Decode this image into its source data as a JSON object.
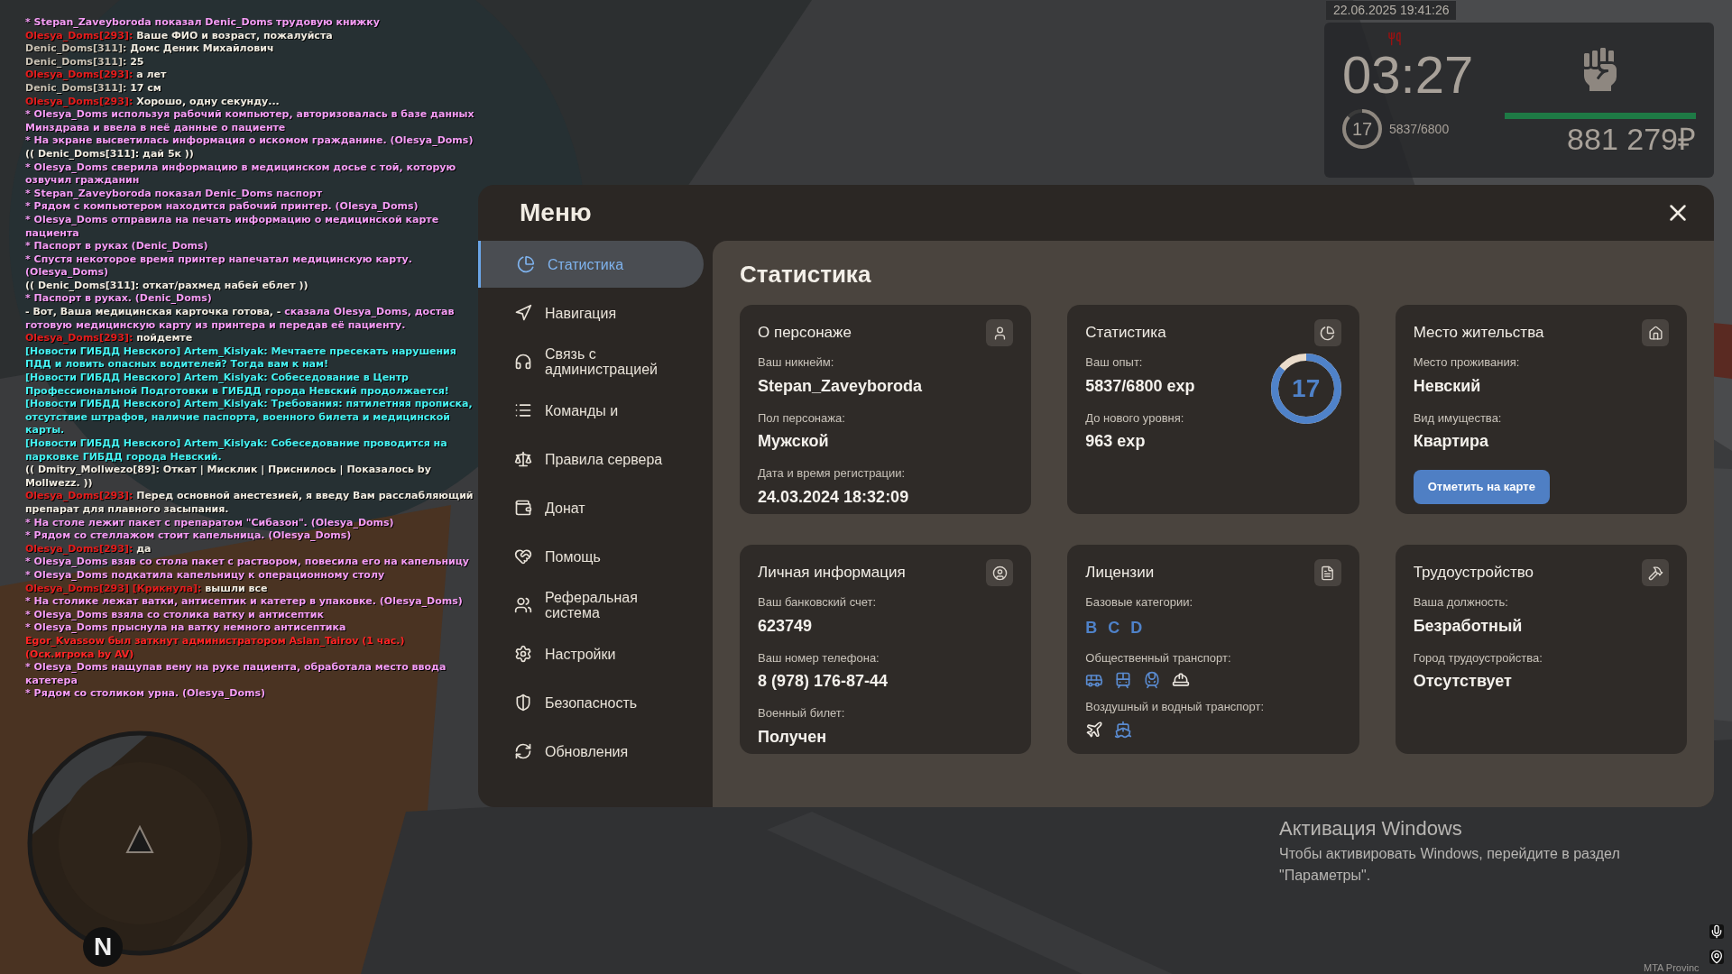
{
  "chat": [
    {
      "segments": [
        {
          "kind": "action",
          "text": "* Stepan_Zaveyboroda показал Denic_Doms трудовую книжку"
        }
      ]
    },
    {
      "segments": [
        {
          "kind": "name",
          "text": "Olesya_Doms[293]:"
        },
        {
          "kind": "speech",
          "text": " Ваше ФИО и возраст, пожалуйста"
        }
      ]
    },
    {
      "segments": [
        {
          "kind": "local",
          "text": "Denic_Doms[311]:"
        },
        {
          "kind": "speech",
          "text": " Домс Деник Михайлович"
        }
      ]
    },
    {
      "segments": [
        {
          "kind": "local",
          "text": "Denic_Doms[311]:"
        },
        {
          "kind": "speech",
          "text": " 25"
        }
      ]
    },
    {
      "segments": [
        {
          "kind": "name",
          "text": "Olesya_Doms[293]:"
        },
        {
          "kind": "speech",
          "text": " а лет"
        }
      ]
    },
    {
      "segments": [
        {
          "kind": "local",
          "text": "Denic_Doms[311]:"
        },
        {
          "kind": "speech",
          "text": " 17 см"
        }
      ]
    },
    {
      "segments": [
        {
          "kind": "name",
          "text": "Olesya_Doms[293]:"
        },
        {
          "kind": "speech",
          "text": " Хорошо, одну секунду..."
        }
      ]
    },
    {
      "segments": [
        {
          "kind": "action",
          "text": "* Olesya_Doms используя рабочий компьютер, авторизовалась в базе данных Минздрава и ввела в неё данные о пациенте"
        }
      ]
    },
    {
      "segments": [
        {
          "kind": "action",
          "text": "* На экране высветилась информация о искомом гражданине. (Olesya_Doms)"
        }
      ]
    },
    {
      "segments": [
        {
          "kind": "speech",
          "text": "(( Denic_Doms[311]: дай 5к ))"
        }
      ]
    },
    {
      "segments": [
        {
          "kind": "action",
          "text": "* Olesya_Doms сверила информацию в медицинском досье с той, которую озвучил гражданин"
        }
      ]
    },
    {
      "segments": [
        {
          "kind": "action",
          "text": "* Stepan_Zaveyboroda показал Denic_Doms паспорт"
        }
      ]
    },
    {
      "segments": [
        {
          "kind": "action",
          "text": "* Рядом с компьютером находится рабочий принтер. (Olesya_Doms)"
        }
      ]
    },
    {
      "segments": [
        {
          "kind": "action",
          "text": "* Olesya_Doms отправила на печать информацию о медицинской карте пациента"
        }
      ]
    },
    {
      "segments": [
        {
          "kind": "action",
          "text": "* Паспорт в руках (Denic_Doms)"
        }
      ]
    },
    {
      "segments": [
        {
          "kind": "action",
          "text": "* Спустя некоторое время принтер напечатал медицинскую карту. (Olesya_Doms)"
        }
      ]
    },
    {
      "segments": [
        {
          "kind": "speech",
          "text": "(( Denic_Doms[311]: откат/рахмед набей еблет ))"
        }
      ]
    },
    {
      "segments": [
        {
          "kind": "action",
          "text": "* Паспорт в руках. (Denic_Doms)"
        }
      ]
    },
    {
      "segments": [
        {
          "kind": "speech",
          "text": "- Вот, Ваша медицинская карточка готова, -"
        },
        {
          "kind": "action",
          "text": " сказала Olesya_Doms, достав готовую медицинскую карту из принтера и передав её пациенту."
        }
      ]
    },
    {
      "segments": [
        {
          "kind": "name",
          "text": "Olesya_Doms[293]:"
        },
        {
          "kind": "speech",
          "text": " пойдемте"
        }
      ]
    },
    {
      "segments": [
        {
          "kind": "news",
          "text": "[Новости ГИБДД Невского] Artem_Kislyak: Мечтаете пресекать нарушения ПДД и ловить опасных водителей? Тогда вам к нам!"
        }
      ]
    },
    {
      "segments": [
        {
          "kind": "news",
          "text": "[Новости ГИБДД Невского] Artem_Kislyak: Собеседование в Центр Профессиональной Подготовки в ГИБДД города Невский продолжается!"
        }
      ]
    },
    {
      "segments": [
        {
          "kind": "news",
          "text": "[Новости ГИБДД Невского] Artem_Kislyak: Требования: пятилетняя прописка, отсутствие штрафов, наличие паспорта, военного билета и медицинской карты."
        }
      ]
    },
    {
      "segments": [
        {
          "kind": "news",
          "text": "[Новости ГИБДД Невского] Artem_Kislyak: Собеседование проводится на парковке ГИБДД города Невский."
        }
      ]
    },
    {
      "segments": [
        {
          "kind": "speech",
          "text": "(( Dmitry_Mollwezo[89]: Откат | Мисклик | Приснилось | Показалось by Mollwezz. ))"
        }
      ]
    },
    {
      "segments": [
        {
          "kind": "name",
          "text": "Olesya_Doms[293]:"
        },
        {
          "kind": "speech",
          "text": " Перед основной анестезией, я введу Вам расслабляющий препарат для плавного засыпания."
        }
      ]
    },
    {
      "segments": [
        {
          "kind": "action",
          "text": "* На столе лежит пакет с препаратом \"Сибазон\". (Olesya_Doms)"
        }
      ]
    },
    {
      "segments": [
        {
          "kind": "action",
          "text": "* Рядом со стеллажом стоит капельница. (Olesya_Doms)"
        }
      ]
    },
    {
      "segments": [
        {
          "kind": "name",
          "text": "Olesya_Doms[293]:"
        },
        {
          "kind": "speech",
          "text": " да"
        }
      ]
    },
    {
      "segments": [
        {
          "kind": "action",
          "text": "* Olesya_Doms взяв со стола пакет с раствором, повесила его на капельницу"
        }
      ]
    },
    {
      "segments": [
        {
          "kind": "action",
          "text": "* Olesya_Doms подкатила капельницу к операционному столу"
        }
      ]
    },
    {
      "segments": [
        {
          "kind": "name",
          "text": "Olesya_Doms[293] [Крикнула]:"
        },
        {
          "kind": "speech",
          "text": " вышли все"
        }
      ]
    },
    {
      "segments": [
        {
          "kind": "action",
          "text": "* На столике лежат ватки, антисептик и катетер в упаковке. (Olesya_Doms)"
        }
      ]
    },
    {
      "segments": [
        {
          "kind": "action",
          "text": "* Olesya_Doms взяла со столика ватку и антисептик"
        }
      ]
    },
    {
      "segments": [
        {
          "kind": "action",
          "text": "* Olesya_Doms прыснула на ватку немного антисептика"
        }
      ]
    },
    {
      "segments": [
        {
          "kind": "admin",
          "text": "Egor_Kvassow был заткнут администратором Aslan_Tairov (1 час.) (Оск.игрока by AV)"
        }
      ]
    },
    {
      "segments": [
        {
          "kind": "action",
          "text": "* Olesya_Doms нащупав вену на руке пациента, обработала место ввода катетера"
        }
      ]
    },
    {
      "segments": [
        {
          "kind": "action",
          "text": "* Рядом со столиком урна. (Olesya_Doms)"
        }
      ]
    }
  ],
  "hud": {
    "datetime": "22.06.2025 19:41:26",
    "time": "03:27",
    "level": "17",
    "level_ring": {
      "level": 0.86
    },
    "experience": "5837/6800",
    "health_bar": {
      "level": 1
    },
    "money": "881 279₽"
  },
  "menu": {
    "title": "Меню",
    "items": [
      {
        "kind": "chart",
        "label": "Статистика",
        "selected": true
      },
      {
        "kind": "navigation",
        "label": "Навигация",
        "selected": false
      },
      {
        "kind": "headphones",
        "label": "Связь с администрацией",
        "selected": false
      },
      {
        "kind": "list",
        "label": "Команды и",
        "selected": false
      },
      {
        "kind": "scale",
        "label": "Правила сервера",
        "selected": false
      },
      {
        "kind": "wallet",
        "label": "Донат",
        "selected": false
      },
      {
        "kind": "handshake",
        "label": "Помощь",
        "selected": false
      },
      {
        "kind": "users",
        "label": "Реферальная система",
        "selected": false
      },
      {
        "kind": "settings",
        "label": "Настройки",
        "selected": false
      },
      {
        "kind": "shield",
        "label": "Безопасность",
        "selected": false
      },
      {
        "kind": "refresh",
        "label": "Обновления",
        "selected": false
      }
    ],
    "heading": "Статистика",
    "cards": [
      {
        "kind": "fields",
        "title": "О персонаже",
        "fields": [
          {
            "label": "Ваш никнейм:",
            "value": "Stepan_Zaveyboroda"
          },
          {
            "label": "Пол персонажа:",
            "value": "Мужской"
          },
          {
            "label": "Дата и время регистрации:",
            "value": "24.03.2024 18:32:09"
          }
        ]
      },
      {
        "kind": "ring",
        "title": "Статистика",
        "fields": [
          {
            "label": "Ваш опыт:",
            "value": "5837/6800 exp"
          },
          {
            "label": "До нового уровня:",
            "value": "963 exp"
          }
        ],
        "ring": {
          "value": "17",
          "level": 0.86
        }
      },
      {
        "kind": "button",
        "title": "Место жительства",
        "fields": [
          {
            "label": "Место проживания:",
            "value": "Невский"
          },
          {
            "label": "Вид имущества:",
            "value": "Квартира"
          }
        ],
        "button": "Отметить на карте"
      },
      {
        "kind": "fields",
        "title": "Личная информация",
        "fields": [
          {
            "label": "Ваш банковский счет:",
            "value": "623749"
          },
          {
            "label": "Ваш номер телефона:",
            "value": "8 (978) 176-87-44"
          },
          {
            "label": "Военный билет:",
            "value": "Получен"
          }
        ]
      },
      {
        "kind": "licenses",
        "title": "Лицензии",
        "sections": [
          {
            "label": "Базовые категории:",
            "letters": [
              {
                "text": "B",
                "owned": true
              },
              {
                "text": "C",
                "owned": true
              },
              {
                "text": "D",
                "owned": true
              }
            ]
          },
          {
            "label": "Общественный транспорт:",
            "vehicles": [
              {
                "kind": "bus",
                "owned": true
              },
              {
                "kind": "tram",
                "owned": true
              },
              {
                "kind": "train",
                "owned": true
              },
              {
                "kind": "hat",
                "owned": false
              }
            ]
          },
          {
            "label": "Воздушный и водный транспорт:",
            "vehicles": [
              {
                "kind": "plane",
                "owned": false
              },
              {
                "kind": "ship",
                "owned": true
              }
            ]
          }
        ]
      },
      {
        "kind": "fields",
        "title": "Трудоустройство",
        "fields": [
          {
            "label": "Ваша должность:",
            "value": "Безработный"
          },
          {
            "label": "Город трудоустройства:",
            "value": "Отсутствует"
          }
        ]
      }
    ]
  },
  "minimap": {
    "north": "N"
  },
  "windows_activation": {
    "title": "Активация Windows",
    "text": "Чтобы активировать Windows, перейдите в раздел \"Параметры\"."
  },
  "server_label": "MTA Provinc"
}
